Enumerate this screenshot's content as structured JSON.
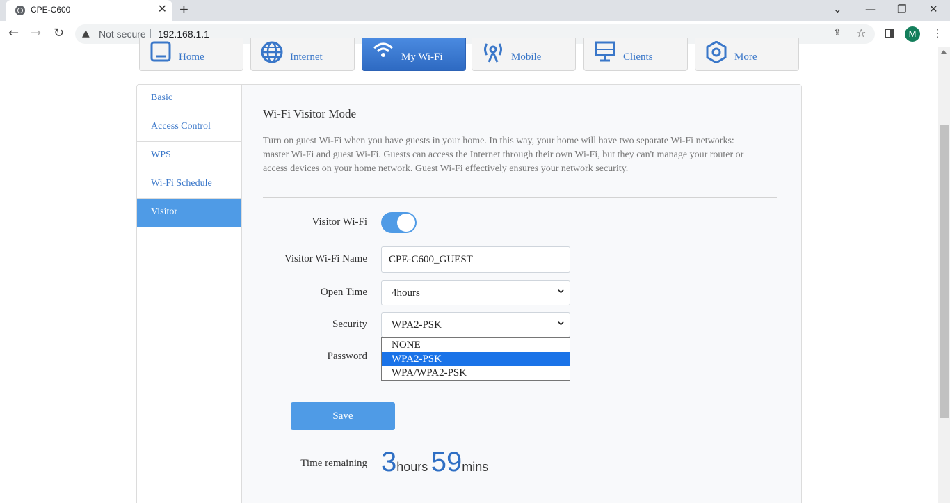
{
  "browser": {
    "tab_title": "CPE-C600",
    "tab_close": "✕",
    "new_tab": "+",
    "security_label": "Not secure",
    "url": "192.168.1.1",
    "profile_initial": "M"
  },
  "nav": {
    "tabs": [
      {
        "label": "Home",
        "icon": "home-icon"
      },
      {
        "label": "Internet",
        "icon": "globe-icon"
      },
      {
        "label": "My Wi-Fi",
        "icon": "wifi-icon",
        "active": true
      },
      {
        "label": "Mobile",
        "icon": "antenna-icon"
      },
      {
        "label": "Clients",
        "icon": "monitor-icon"
      },
      {
        "label": "More",
        "icon": "gear-icon"
      }
    ]
  },
  "sidebar": {
    "items": [
      {
        "label": "Basic"
      },
      {
        "label": "Access Control"
      },
      {
        "label": "WPS"
      },
      {
        "label": "Wi-Fi Schedule"
      },
      {
        "label": "Visitor",
        "active": true
      }
    ]
  },
  "visitor": {
    "title": "Wi-Fi Visitor Mode",
    "description": "Turn on guest Wi-Fi when you have guests in your home. In this way, your home will have two separate Wi-Fi networks: master Wi-Fi and guest Wi-Fi. Guests can access the Internet through their own Wi-Fi, but they can't manage your router or access devices on your home network. Guest Wi-Fi effectively ensures your network security.",
    "visitor_wifi_label": "Visitor Wi-Fi",
    "visitor_wifi_enabled": true,
    "name_label": "Visitor Wi-Fi Name",
    "name_value": "CPE-C600_GUEST",
    "open_time_label": "Open Time",
    "open_time_value": "4hours",
    "security_label": "Security",
    "security_value": "WPA2-PSK",
    "security_options": [
      "NONE",
      "WPA2-PSK",
      "WPA/WPA2-PSK"
    ],
    "security_selected_index": 1,
    "password_label": "Password",
    "save_label": "Save",
    "time_remaining_label": "Time remaining",
    "remaining_hours": "3",
    "hours_unit": "hours",
    "remaining_mins": "59",
    "mins_unit": "mins"
  },
  "colors": {
    "accent": "#4f9be6",
    "link": "#3a77c9",
    "active_nav": "#3a7bd5",
    "dropdown_highlight": "#1a73e8"
  }
}
